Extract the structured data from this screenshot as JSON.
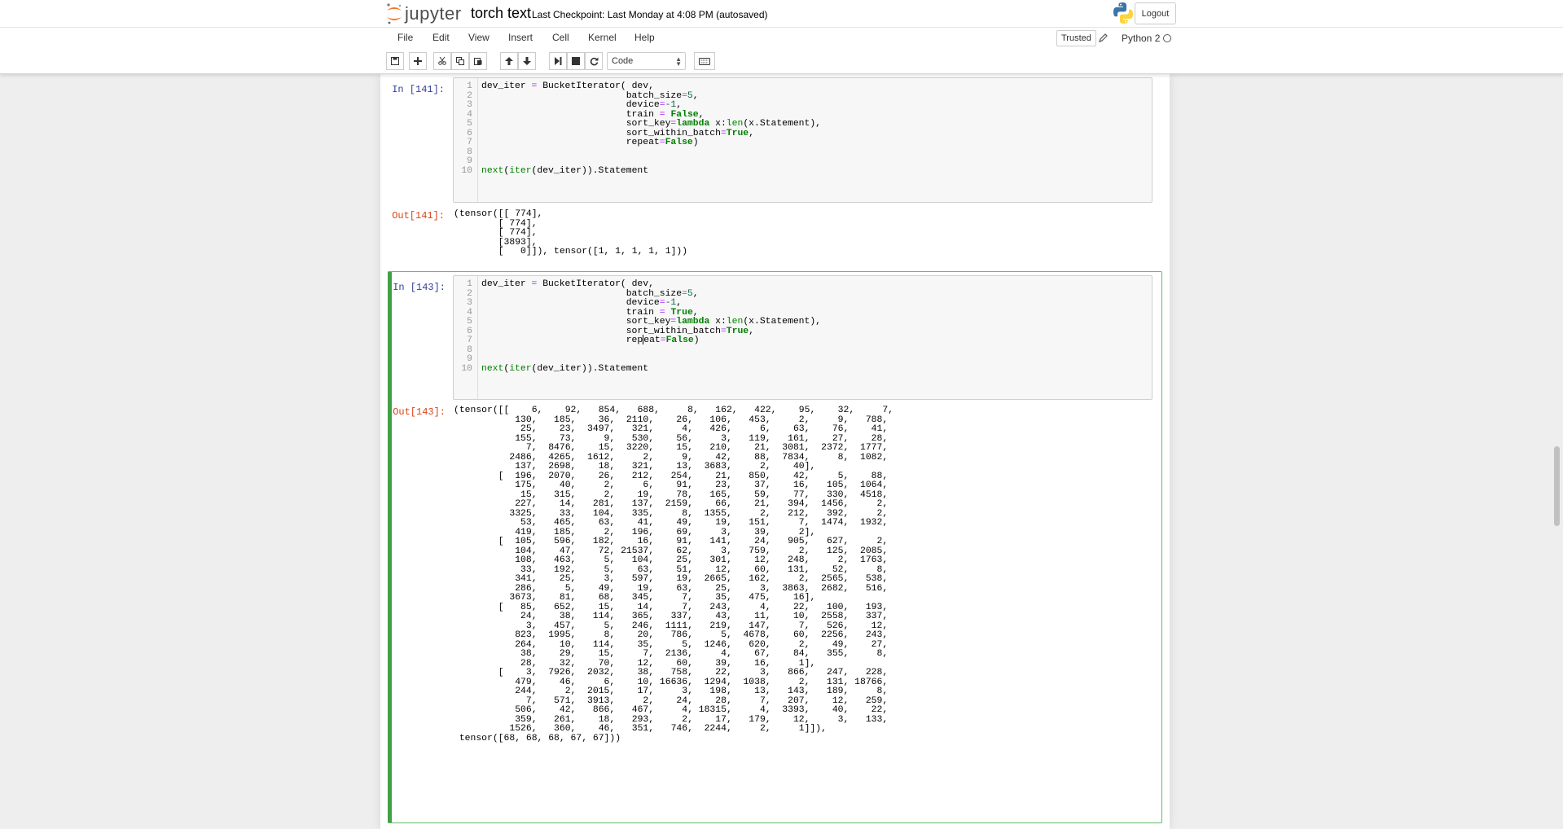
{
  "header": {
    "logo_text": "jupyter",
    "notebook_name": "torch text",
    "checkpoint": "Last Checkpoint: Last Monday at 4:08 PM (autosaved)",
    "logout_label": "Logout"
  },
  "menubar": {
    "items": [
      "File",
      "Edit",
      "View",
      "Insert",
      "Cell",
      "Kernel",
      "Help"
    ],
    "trusted_label": "Trusted",
    "kernel_name": "Python 2"
  },
  "toolbar": {
    "cell_type": "Code"
  },
  "cells": [
    {
      "in_prompt": "In [141]:",
      "out_prompt": "Out[141]:",
      "code": [
        "dev_iter = BucketIterator( dev,",
        "                          batch_size=5,",
        "                          device=-1,",
        "                          train = False,",
        "                          sort_key=lambda x:len(x.Statement),",
        "                          sort_within_batch=True,",
        "                          repeat=False)",
        "",
        "",
        "next(iter(dev_iter)).Statement"
      ],
      "output": [
        "(tensor([[ 774],",
        "        [ 774],",
        "        [ 774],",
        "        [3893],",
        "        [   0]]), tensor([1, 1, 1, 1, 1]))"
      ]
    },
    {
      "in_prompt": "In [143]:",
      "out_prompt": "Out[143]:",
      "code": [
        "dev_iter = BucketIterator( dev,",
        "                          batch_size=5,",
        "                          device=-1,",
        "                          train = True,",
        "                          sort_key=lambda x:len(x.Statement),",
        "                          sort_within_batch=True,",
        "                          repeat=False)",
        "",
        "",
        "next(iter(dev_iter)).Statement"
      ],
      "output": [
        "(tensor([[    6,    92,   854,   688,     8,   162,   422,    95,    32,     7,",
        "           130,   185,    36,  2110,    26,   106,   453,     2,     9,   788,",
        "            25,    23,  3497,   321,     4,   426,     6,    63,    76,    41,",
        "           155,    73,     9,   530,    56,     3,   119,   161,    27,    28,",
        "             7,  8476,    15,  3220,    15,   210,    21,  3081,  2372,  1777,",
        "          2486,  4265,  1612,     2,     9,    42,    88,  7834,     8,  1082,",
        "           137,  2698,    18,   321,    13,  3683,     2,    40],",
        "        [  196,  2070,    26,   212,   254,    21,   850,    42,     5,    88,",
        "           175,    40,     2,     6,    91,    23,    37,    16,   105,  1064,",
        "            15,   315,     2,    19,    78,   165,    59,    77,   330,  4518,",
        "           227,    14,   281,   137,  2159,    66,    21,   394,  1456,     2,",
        "          3325,    33,   104,   335,     8,  1355,     2,   212,   392,     2,",
        "            53,   465,    63,    41,    49,    19,   151,     7,  1474,  1932,",
        "           419,   185,     2,   196,    69,     3,    39,     2],",
        "        [  105,   596,   182,    16,    91,   141,    24,   905,   627,     2,",
        "           104,    47,    72, 21537,    62,     3,   759,     2,   125,  2085,",
        "           108,   463,     5,   104,    25,   301,    12,   248,     2,  1763,",
        "            33,   192,     5,    63,    51,    12,    60,   131,    52,     8,",
        "           341,    25,     3,   597,    19,  2665,   162,     2,  2565,   538,",
        "           286,     5,    49,    19,    63,    25,     3,  3863,  2682,   516,",
        "          3673,    81,    68,   345,     7,    35,   475,    16],",
        "        [   85,   652,    15,    14,     7,   243,     4,    22,   100,   193,",
        "            24,    38,   114,   365,   337,    43,    11,    10,  2558,   337,",
        "             3,   457,     5,   246,  1111,   219,   147,     7,   526,    12,",
        "           823,  1995,     8,    20,   786,     5,  4678,    60,  2256,   243,",
        "           264,    10,   114,    35,     5,  1246,   620,     2,    49,    27,",
        "            38,    29,    15,     7,  2136,     4,    67,    84,   355,     8,",
        "            28,    32,    70,    12,    60,    39,    16,     1],",
        "        [    3,  7926,  2032,    38,   758,    22,     3,   866,   247,   228,",
        "           479,    46,     6,    10, 16636,  1294,  1038,     2,   131, 18766,",
        "           244,     2,  2015,    17,     3,   198,    13,   143,   189,     8,",
        "             7,   571,  3913,     2,    24,    28,     7,   207,    12,   259,",
        "           506,    42,   866,   467,     4, 18315,     4,  3393,    40,    22,",
        "           359,   261,    18,   293,     2,    17,   179,    12,     3,   133,",
        "          1526,   360,    46,   351,   746,  2244,     2,     1]]),",
        " tensor([68, 68, 68, 67, 67]))"
      ]
    }
  ],
  "colors": {
    "in_prompt": "#303f9f",
    "out_prompt": "#d84315",
    "keyword": "#008000",
    "number": "#116644",
    "selected_border": "#42a047"
  },
  "icons": [
    "jupyter-logo-icon",
    "python-logo-icon",
    "save-icon",
    "plus-icon",
    "cut-icon",
    "copy-icon",
    "paste-icon",
    "arrow-up-icon",
    "arrow-down-icon",
    "run-icon",
    "stop-icon",
    "restart-icon",
    "keyboard-icon",
    "pencil-icon",
    "kernel-status-icon"
  ]
}
